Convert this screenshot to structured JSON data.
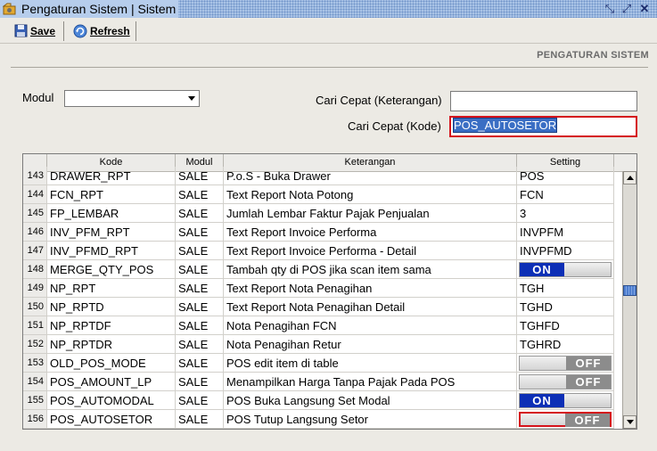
{
  "window": {
    "title": "Pengaturan Sistem | Sistem"
  },
  "toolbar": {
    "save_label": "Save",
    "refresh_label": "Refresh"
  },
  "panel": {
    "title": "PENGATURAN SISTEM"
  },
  "filters": {
    "modul_label": "Modul",
    "modul_value": "",
    "cari_keterangan_label": "Cari Cepat (Keterangan)",
    "cari_keterangan_value": "",
    "cari_kode_label": "Cari Cepat (Kode)",
    "cari_kode_value": "POS_AUTOSETOR"
  },
  "grid": {
    "columns": [
      "Kode",
      "Modul",
      "Keterangan",
      "Setting"
    ],
    "rows": [
      {
        "no": "143",
        "kode": "DRAWER_RPT",
        "modul": "SALE",
        "keterangan": "P.o.S - Buka Drawer",
        "setting": "POS",
        "type": "text"
      },
      {
        "no": "144",
        "kode": "FCN_RPT",
        "modul": "SALE",
        "keterangan": "Text Report Nota Potong",
        "setting": "FCN",
        "type": "text"
      },
      {
        "no": "145",
        "kode": "FP_LEMBAR",
        "modul": "SALE",
        "keterangan": "Jumlah Lembar Faktur Pajak Penjualan",
        "setting": "3",
        "type": "text"
      },
      {
        "no": "146",
        "kode": "INV_PFM_RPT",
        "modul": "SALE",
        "keterangan": "Text Report Invoice Performa",
        "setting": "INVPFM",
        "type": "text"
      },
      {
        "no": "147",
        "kode": "INV_PFMD_RPT",
        "modul": "SALE",
        "keterangan": "Text Report Invoice Performa - Detail",
        "setting": "INVPFMD",
        "type": "text"
      },
      {
        "no": "148",
        "kode": "MERGE_QTY_POS",
        "modul": "SALE",
        "keterangan": "Tambah qty di POS jika scan item sama",
        "setting": "ON",
        "type": "on"
      },
      {
        "no": "149",
        "kode": "NP_RPT",
        "modul": "SALE",
        "keterangan": "Text Report Nota Penagihan",
        "setting": "TGH",
        "type": "text"
      },
      {
        "no": "150",
        "kode": "NP_RPTD",
        "modul": "SALE",
        "keterangan": "Text Report Nota Penagihan Detail",
        "setting": "TGHD",
        "type": "text"
      },
      {
        "no": "151",
        "kode": "NP_RPTDF",
        "modul": "SALE",
        "keterangan": "Nota Penagihan FCN",
        "setting": "TGHFD",
        "type": "text"
      },
      {
        "no": "152",
        "kode": "NP_RPTDR",
        "modul": "SALE",
        "keterangan": "Nota Penagihan Retur",
        "setting": "TGHRD",
        "type": "text"
      },
      {
        "no": "153",
        "kode": "OLD_POS_MODE",
        "modul": "SALE",
        "keterangan": "POS edit item di table",
        "setting": "OFF",
        "type": "off"
      },
      {
        "no": "154",
        "kode": "POS_AMOUNT_LP",
        "modul": "SALE",
        "keterangan": "Menampilkan Harga Tanpa Pajak Pada POS",
        "setting": "OFF",
        "type": "off"
      },
      {
        "no": "155",
        "kode": "POS_AUTOMODAL",
        "modul": "SALE",
        "keterangan": "POS Buka Langsung Set Modal",
        "setting": "ON",
        "type": "on"
      },
      {
        "no": "156",
        "kode": "POS_AUTOSETOR",
        "modul": "SALE",
        "keterangan": "POS Tutup Langsung Setor",
        "setting": "OFF",
        "type": "off",
        "highlight": true
      }
    ]
  },
  "colors": {
    "accent_on": "#0d2fb6",
    "highlight": "#d5121b",
    "selection": "#3a6ec4"
  }
}
